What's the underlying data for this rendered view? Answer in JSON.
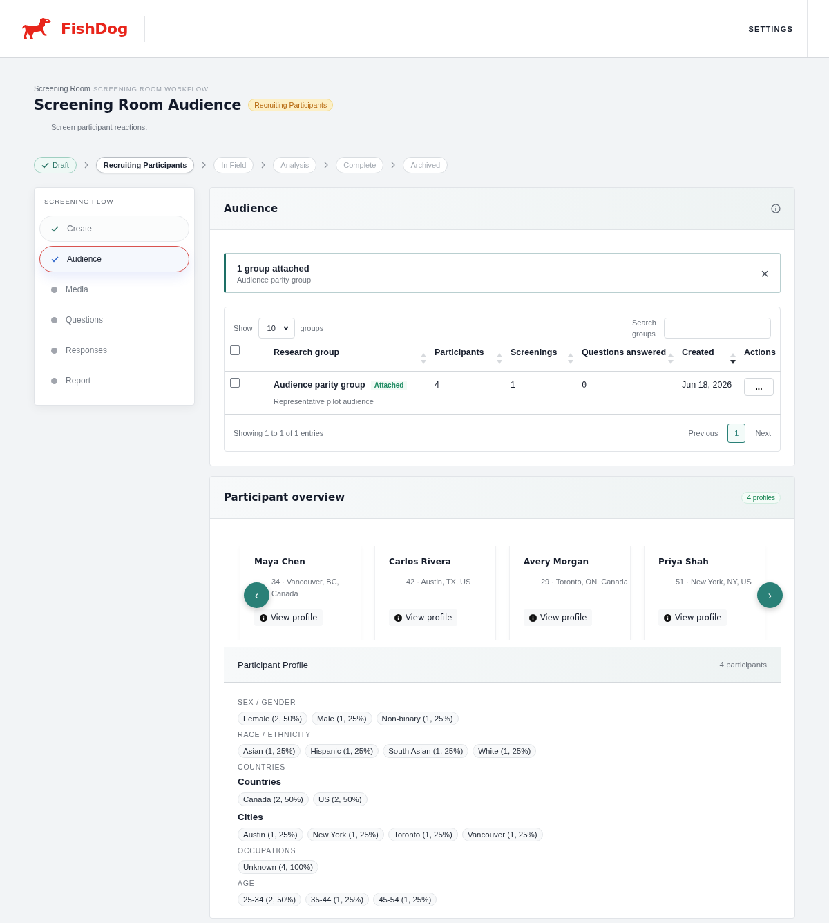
{
  "header": {
    "brand": "FishDog",
    "settings": "SETTINGS"
  },
  "page": {
    "breadcrumb": "Screening Room",
    "breadcrumb_sub": "SCREENING ROOM WORKFLOW",
    "title": "Screening Room Audience",
    "status_badge": "Recruiting Participants",
    "subtitle": "Screen participant reactions."
  },
  "stepper": [
    {
      "label": "Draft",
      "done": true,
      "selected": false
    },
    {
      "label": "Recruiting Participants",
      "done": false,
      "selected": true
    },
    {
      "label": "In Field",
      "done": false,
      "selected": false
    },
    {
      "label": "Analysis",
      "done": false,
      "selected": false
    },
    {
      "label": "Complete",
      "done": false,
      "selected": false
    },
    {
      "label": "Archived",
      "done": false,
      "selected": false
    }
  ],
  "sidebar": {
    "title": "SCREENING FLOW",
    "items": [
      {
        "label": "Create",
        "done": true,
        "selected": false
      },
      {
        "label": "Audience",
        "done": true,
        "selected": true
      },
      {
        "label": "Media",
        "done": false,
        "selected": false
      },
      {
        "label": "Questions",
        "done": false,
        "selected": false
      },
      {
        "label": "Responses",
        "done": false,
        "selected": false
      },
      {
        "label": "Report",
        "done": false,
        "selected": false
      }
    ]
  },
  "audience": {
    "title": "Audience",
    "notice": {
      "title": "1 group attached",
      "text": "Audience parity group",
      "close": "×"
    },
    "table": {
      "show_label": "Show",
      "page_size": "10",
      "groups_label": "groups",
      "search_label": "Search groups",
      "header_checked": false,
      "columns": [
        {
          "label": "Research group",
          "sortable": true,
          "sorted": false
        },
        {
          "label": "Participants",
          "sortable": true,
          "sorted": false
        },
        {
          "label": "Screenings",
          "sortable": true,
          "sorted": false
        },
        {
          "label": "Questions answered",
          "sortable": true,
          "sorted": false
        },
        {
          "label": "Created",
          "sortable": true,
          "sorted": true
        },
        {
          "label": "Actions",
          "sortable": false
        }
      ],
      "rows": [
        {
          "checked": false,
          "name": "Audience parity group",
          "badge": "Attached",
          "description": "Representative pilot audience",
          "participants": "4",
          "screenings": "1",
          "questions_answered": "0",
          "created": "Jun 18, 2026",
          "action": "..."
        }
      ],
      "info": "Showing 1 to 1 of 1 entries",
      "previous": "Previous",
      "pages": [
        {
          "label": "1",
          "selected": true
        }
      ],
      "next": "Next"
    }
  },
  "overview": {
    "title": "Participant overview",
    "badge": "4 profiles",
    "prev": "‹",
    "next": "›",
    "participants": [
      {
        "name": "Maya Chen",
        "details": "34 · Vancouver, BC, Canada",
        "action": "View profile"
      },
      {
        "name": "Carlos Rivera",
        "details": "42 · Austin, TX, US",
        "action": "View profile"
      },
      {
        "name": "Avery Morgan",
        "details": "29 · Toronto, ON, Canada",
        "action": "View profile"
      },
      {
        "name": "Priya Shah",
        "details": "51 · New York, NY, US",
        "action": "View profile"
      }
    ]
  },
  "profile": {
    "title": "Participant Profile",
    "count": "4 participants",
    "blocks": [
      {
        "kind": "caps",
        "label": "SEX / GENDER",
        "chips": [
          "Female (2, 50%)",
          "Male (1, 25%)",
          "Non-binary (1, 25%)"
        ]
      },
      {
        "kind": "caps",
        "label": "RACE / ETHNICITY",
        "chips": [
          "Asian (1, 25%)",
          "Hispanic (1, 25%)",
          "South Asian (1, 25%)",
          "White (1, 25%)"
        ]
      },
      {
        "kind": "caps",
        "label": "COUNTRIES"
      },
      {
        "kind": "heading",
        "label": "Countries",
        "chips": [
          "Canada (2, 50%)",
          "US (2, 50%)"
        ]
      },
      {
        "kind": "heading",
        "label": "Cities",
        "chips": [
          "Austin (1, 25%)",
          "New York (1, 25%)",
          "Toronto (1, 25%)",
          "Vancouver (1, 25%)"
        ]
      },
      {
        "kind": "caps",
        "label": "OCCUPATIONS",
        "chips": [
          "Unknown (4, 100%)"
        ]
      },
      {
        "kind": "caps",
        "label": "AGE",
        "chips": [
          "25-34 (2, 50%)",
          "35-44 (1, 25%)",
          "45-54 (1, 25%)"
        ]
      }
    ]
  }
}
